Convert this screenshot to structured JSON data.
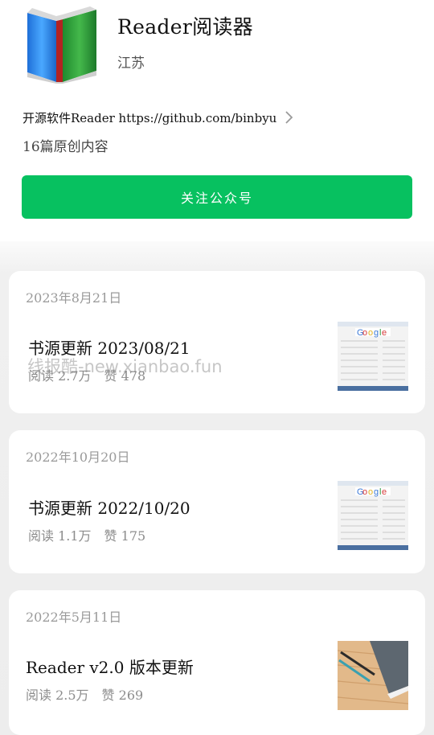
{
  "profile": {
    "name": "Reader阅读器",
    "region": "江苏",
    "description": "开源软件Reader https://github.com/binbyu",
    "article_count": "16篇原创内容",
    "follow_label": "关注公众号"
  },
  "icons": {
    "app": "book-icon",
    "chevron": "chevron-right-icon"
  },
  "colors": {
    "accent": "#07c160"
  },
  "articles": [
    {
      "date": "2023年8月21日",
      "title": "书源更新 2023/08/21",
      "reads": "阅读 2.7万",
      "likes": "赞 478",
      "thumb": "settings-screenshot"
    },
    {
      "date": "2022年10月20日",
      "title": "书源更新 2022/10/20",
      "reads": "阅读 1.1万",
      "likes": "赞 175",
      "thumb": "settings-screenshot"
    },
    {
      "date": "2022年5月11日",
      "title": "Reader v2.0 版本更新",
      "reads": "阅读 2.5万",
      "likes": "赞 269",
      "thumb": "notebook-pencils-photo"
    }
  ],
  "watermark": "线报酷-new.xianbao.fun"
}
